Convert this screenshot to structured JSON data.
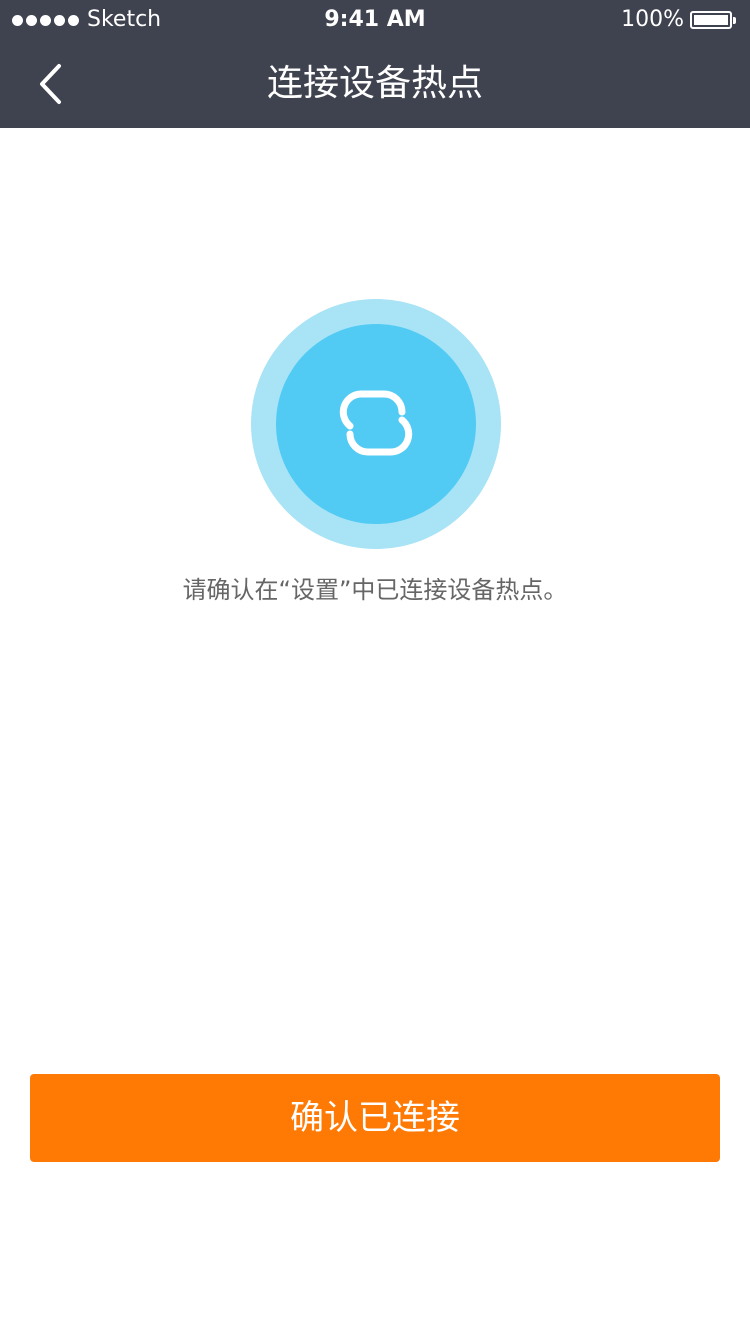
{
  "status_bar": {
    "carrier": "Sketch",
    "time": "9:41 AM",
    "battery": "100%"
  },
  "nav": {
    "title": "连接设备热点"
  },
  "content": {
    "hint": "请确认在“设置”中已连接设备热点。"
  },
  "actions": {
    "confirm_label": "确认已连接"
  },
  "icons": {
    "back": "back-arrow-icon",
    "hero": "link-icon",
    "battery": "battery-icon",
    "signal": "signal-icon"
  },
  "colors": {
    "header_bg": "#3f424f",
    "hero_outer": "#a9e3f6",
    "hero_inner": "#52cbf4",
    "button_bg": "#ff7a05",
    "hint_text": "#666666"
  }
}
